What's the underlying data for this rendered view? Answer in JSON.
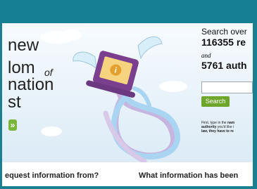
{
  "hero": {
    "title_line_1": "new",
    "title_line_2": "lom",
    "title_of": "of",
    "title_line_3": "nation",
    "title_line_4": "st",
    "button_glyph": "»"
  },
  "search": {
    "label": "Search over",
    "requests_count": "116355 re",
    "and_text": "and",
    "authorities_count": "5761 auth",
    "button_label": "Search",
    "help_text_1": "First, type in the ",
    "help_text_bold_1": "nam",
    "help_text_2": "authority",
    "help_text_3": " you'd like i",
    "help_text_4": "law, they have to re"
  },
  "bottom": {
    "question_left": "equest information from?",
    "question_right": "What information has been"
  },
  "colors": {
    "top_bar": "#177f93",
    "frame": "#1b7f92",
    "hero_bg": "#eaf4fb",
    "green": "#6ea62b",
    "laptop": "#7a3f8e",
    "screen": "#f6d37f",
    "info_icon": "#e5a12f",
    "wing": "#d8eef9",
    "ribbon_blue": "#a9d5f2",
    "ribbon_purple": "#c6b6df"
  },
  "icons": {
    "info": "info-icon",
    "laptop": "laptop-icon",
    "wing": "wing-icon",
    "cloud": "cloud-icon",
    "chevron": "chevron-right-icon"
  }
}
